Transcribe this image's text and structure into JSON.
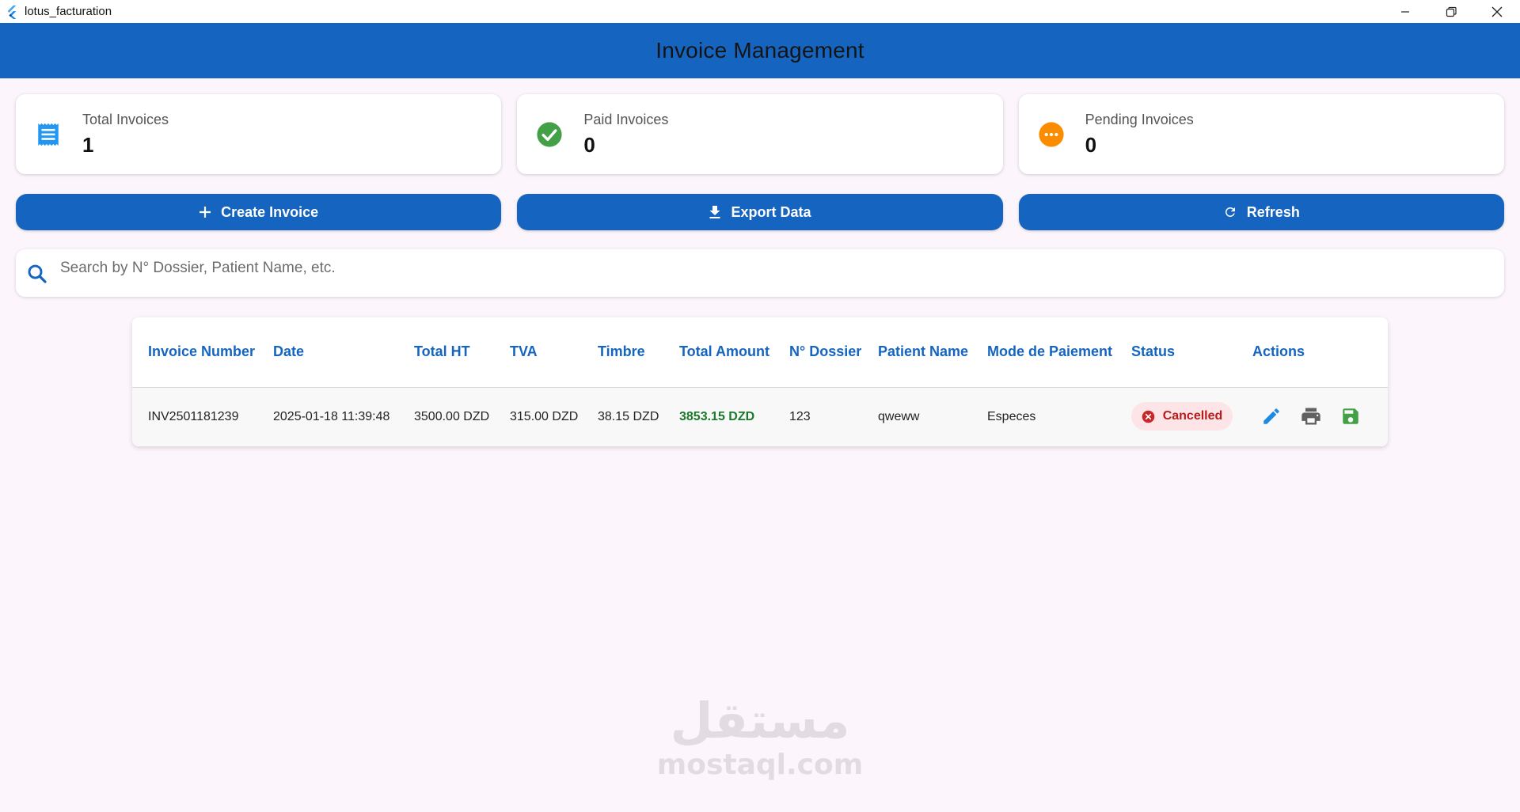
{
  "window": {
    "title": "lotus_facturation",
    "controls": [
      "minimize",
      "restore",
      "close"
    ]
  },
  "appbar": {
    "title": "Invoice Management"
  },
  "stats": [
    {
      "label": "Total Invoices",
      "value": "1",
      "icon": "receipt-icon",
      "color": "#2196f3"
    },
    {
      "label": "Paid Invoices",
      "value": "0",
      "icon": "check-circle-icon",
      "color": "#43a047"
    },
    {
      "label": "Pending Invoices",
      "value": "0",
      "icon": "pending-icon",
      "color": "#fb8c00"
    }
  ],
  "actions": {
    "create": "Create Invoice",
    "export": "Export Data",
    "refresh": "Refresh"
  },
  "search": {
    "placeholder": "Search by N° Dossier, Patient Name, etc."
  },
  "table": {
    "headers": [
      "Invoice Number",
      "Date",
      "Total HT",
      "TVA",
      "Timbre",
      "Total Amount",
      "N° Dossier",
      "Patient Name",
      "Mode de Paiement",
      "Status",
      "Actions"
    ],
    "rows": [
      {
        "invoice_number": "INV2501181239",
        "date": "2025-01-18 11:39:48",
        "total_ht": "3500.00 DZD",
        "tva": "315.00 DZD",
        "timbre": "38.15 DZD",
        "total_amount": "3853.15 DZD",
        "dossier": "123",
        "patient_name": "qweww",
        "mode_paiement": "Especes",
        "status": "Cancelled"
      }
    ]
  },
  "watermark": {
    "arabic": "مستقل",
    "latin": "mostaql.com"
  },
  "colors": {
    "primary": "#1565c0",
    "background": "#fcf6fc",
    "amount_green": "#1b7a2a",
    "cancelled_red": "#c62828"
  }
}
